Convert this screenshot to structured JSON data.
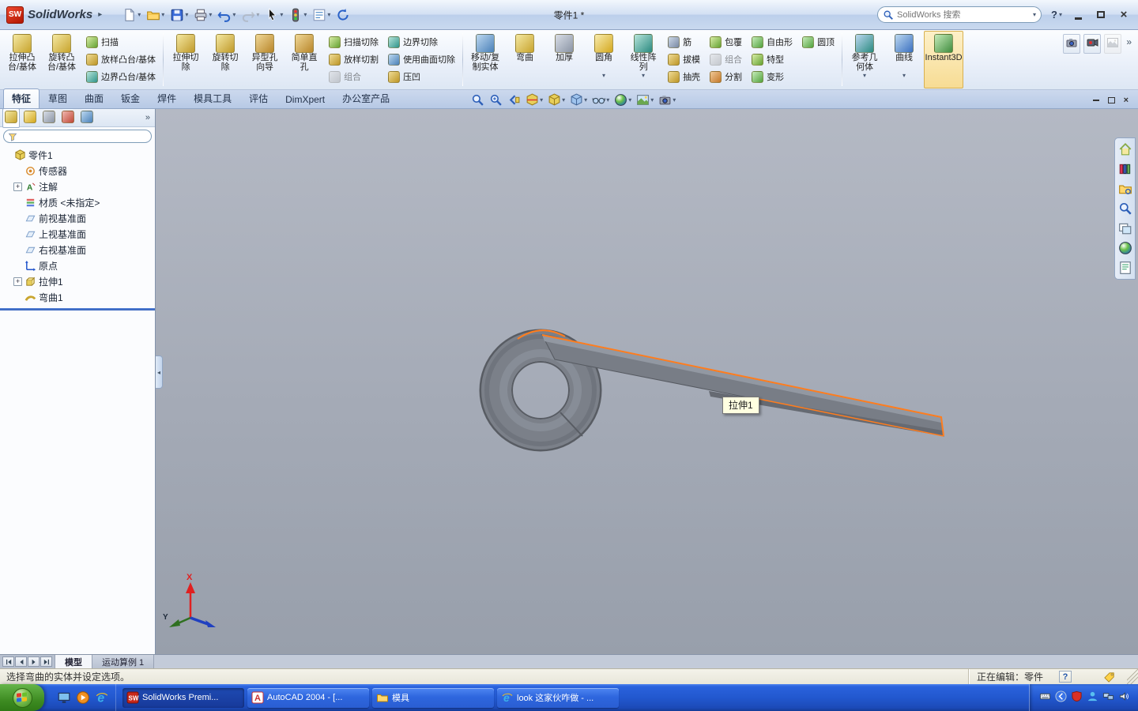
{
  "colors": {
    "selection_highlight": "#ff7d1e",
    "taskbar_blue": "#245edc",
    "viewport_gray": "#a6acb8",
    "accent_red": "#c8281a"
  },
  "titlebar": {
    "logo_badge": "SW",
    "logo_text": "SolidWorks",
    "doc_title": "零件1 *",
    "search_placeholder": "SolidWorks 搜索",
    "help_label": "?"
  },
  "quick_toolbar": [
    {
      "name": "new-document-button",
      "icon": "new-page-icon",
      "dropdown": true
    },
    {
      "name": "open-button",
      "icon": "open-folder-icon",
      "dropdown": true
    },
    {
      "name": "save-button",
      "icon": "save-icon",
      "dropdown": true
    },
    {
      "name": "print-button",
      "icon": "print-icon",
      "dropdown": true
    },
    {
      "name": "undo-button",
      "icon": "undo-icon",
      "dropdown": true
    },
    {
      "name": "redo-button",
      "icon": "redo-icon",
      "dropdown": true,
      "disabled": true
    },
    {
      "name": "select-button",
      "icon": "select-cursor-icon",
      "dropdown": true
    },
    {
      "name": "rebuild-button",
      "icon": "rebuild-icon",
      "dropdown": true
    },
    {
      "name": "options-button",
      "icon": "options-icon",
      "dropdown": true
    },
    {
      "name": "refresh-button",
      "icon": "refresh-icon",
      "dropdown": false
    }
  ],
  "ribbon": {
    "groups": [
      {
        "columns": [
          {
            "type": "big",
            "items": [
              {
                "name": "extruded-boss-button",
                "label_lines": [
                  "拉伸凸",
                  "台/基体"
                ],
                "icon": "extruded-boss-icon"
              },
              {
                "name": "revolved-boss-button",
                "label_lines": [
                  "旋转凸",
                  "台/基体"
                ],
                "icon": "revolved-boss-icon"
              }
            ]
          },
          {
            "type": "stack",
            "items": [
              {
                "name": "swept-boss-button",
                "label": "扫描",
                "icon": "swept-boss-icon"
              },
              {
                "name": "lofted-boss-button",
                "label": "放样凸台/基体",
                "icon": "lofted-boss-icon"
              },
              {
                "name": "boundary-boss-button",
                "label": "边界凸台/基体",
                "icon": "boundary-boss-icon"
              }
            ]
          }
        ]
      },
      {
        "columns": [
          {
            "type": "big",
            "items": [
              {
                "name": "extruded-cut-button",
                "label_lines": [
                  "拉伸切",
                  "除"
                ],
                "icon": "extruded-cut-icon"
              },
              {
                "name": "revolved-cut-button",
                "label_lines": [
                  "旋转切",
                  "除"
                ],
                "icon": "revolved-cut-icon"
              },
              {
                "name": "hole-wizard-button",
                "label_lines": [
                  "异型孔",
                  "向导"
                ],
                "icon": "hole-wizard-icon"
              },
              {
                "name": "simple-hole-button",
                "label_lines": [
                  "简单直",
                  "孔"
                ],
                "icon": "simple-hole-icon"
              }
            ]
          },
          {
            "type": "stack",
            "items": [
              {
                "name": "swept-cut-button",
                "label": "扫描切除",
                "icon": "swept-cut-icon"
              },
              {
                "name": "lofted-cut-button",
                "label": "放样切割",
                "icon": "lofted-cut-icon"
              },
              {
                "name": "combine-button",
                "label": "组合",
                "icon": "combine-icon",
                "disabled": true
              }
            ]
          },
          {
            "type": "stack",
            "items": [
              {
                "name": "boundary-cut-button",
                "label": "边界切除",
                "icon": "boundary-cut-icon"
              },
              {
                "name": "cut-with-surface-button",
                "label": "使用曲面切除",
                "icon": "cut-with-surface-icon"
              },
              {
                "name": "indent-button",
                "label": "压凹",
                "icon": "indent-icon"
              }
            ]
          }
        ]
      },
      {
        "columns": [
          {
            "type": "big",
            "items": [
              {
                "name": "move-copy-bodies-button",
                "label_lines": [
                  "移动/复",
                  "制实体"
                ],
                "icon": "move-copy-icon"
              },
              {
                "name": "flex-button",
                "label_lines": [
                  "弯曲",
                  ""
                ],
                "icon": "flex-icon"
              },
              {
                "name": "thicken-button",
                "label_lines": [
                  "加厚",
                  ""
                ],
                "icon": "thicken-icon"
              },
              {
                "name": "fillet-button",
                "label_lines": [
                  "圆角",
                  ""
                ],
                "icon": "fillet-icon",
                "dropdown": true
              },
              {
                "name": "linear-pattern-button",
                "label_lines": [
                  "线性阵",
                  "列"
                ],
                "icon": "linear-pattern-icon",
                "dropdown": true
              }
            ]
          },
          {
            "type": "stack",
            "items": [
              {
                "name": "rib-button",
                "label": "筋",
                "icon": "rib-icon"
              },
              {
                "name": "draft-button",
                "label": "拔模",
                "icon": "draft-icon"
              },
              {
                "name": "shell-button",
                "label": "抽壳",
                "icon": "shell-icon"
              }
            ]
          },
          {
            "type": "stack",
            "items": [
              {
                "name": "wrap-button",
                "label": "包覆",
                "icon": "wrap-icon"
              },
              {
                "name": "combine-bodies-button",
                "label": "组合",
                "icon": "combine-icon",
                "disabled": true
              },
              {
                "name": "split-button",
                "label": "分割",
                "icon": "split-icon"
              }
            ]
          },
          {
            "type": "stack",
            "items": [
              {
                "name": "freeform-button",
                "label": "自由形",
                "icon": "freeform-icon"
              },
              {
                "name": "shape-feature-button",
                "label": "特型",
                "icon": "shape-feature-icon"
              },
              {
                "name": "deform-button",
                "label": "变形",
                "icon": "deform-icon"
              }
            ]
          },
          {
            "type": "stack",
            "items": [
              {
                "name": "dome-button",
                "label": "圆顶",
                "icon": "dome-icon"
              }
            ]
          }
        ]
      },
      {
        "columns": [
          {
            "type": "big",
            "items": [
              {
                "name": "reference-geometry-button",
                "label_lines": [
                  "参考几",
                  "何体"
                ],
                "icon": "reference-geometry-icon",
                "dropdown": true
              },
              {
                "name": "curves-button",
                "label_lines": [
                  "曲线",
                  ""
                ],
                "icon": "curves-icon",
                "dropdown": true
              },
              {
                "name": "instant3d-button",
                "label_lines": [
                  "Instant3D",
                  ""
                ],
                "icon": "instant3d-icon",
                "active": true
              }
            ]
          }
        ]
      }
    ]
  },
  "ribbon_extras": [
    {
      "name": "screen-capture-button",
      "icon": "camera-icon"
    },
    {
      "name": "record-video-button",
      "icon": "record-icon"
    },
    {
      "name": "capture-options-button",
      "icon": "image-icon",
      "disabled": true
    }
  ],
  "more_chevron": "»",
  "command_tabs": [
    {
      "label": "特征",
      "active": true
    },
    {
      "label": "草图"
    },
    {
      "label": "曲面"
    },
    {
      "label": "钣金"
    },
    {
      "label": "焊件"
    },
    {
      "label": "模具工具"
    },
    {
      "label": "评估"
    },
    {
      "label": "DimXpert"
    },
    {
      "label": "办公室产品"
    }
  ],
  "view_toolbar": [
    {
      "name": "zoom-to-fit-button",
      "icon": "magnifier-icon"
    },
    {
      "name": "zoom-to-area-button",
      "icon": "magnifier-plus-icon"
    },
    {
      "name": "previous-view-button",
      "icon": "previous-view-icon"
    },
    {
      "name": "section-view-button",
      "icon": "section-view-icon",
      "dropdown": true
    },
    {
      "name": "view-orientation-button",
      "icon": "view-cube-icon",
      "dropdown": true
    },
    {
      "name": "display-style-button",
      "icon": "display-style-icon",
      "dropdown": true
    },
    {
      "name": "hide-show-items-button",
      "icon": "hide-show-icon",
      "dropdown": true
    },
    {
      "name": "edit-appearance-button",
      "icon": "appearance-sphere-icon",
      "dropdown": true
    },
    {
      "name": "apply-scene-button",
      "icon": "scene-icon",
      "dropdown": true
    },
    {
      "name": "view-settings-button",
      "icon": "camera-icon",
      "dropdown": true
    }
  ],
  "panel_tabs": [
    {
      "name": "featuremanager-tab",
      "icon": "feature-tree-icon",
      "active": true
    },
    {
      "name": "propertymanager-tab",
      "icon": "property-manager-icon"
    },
    {
      "name": "configurationmanager-tab",
      "icon": "configuration-manager-icon"
    },
    {
      "name": "dimxpertmanager-tab",
      "icon": "dimxpert-manager-icon"
    },
    {
      "name": "displaymanager-tab",
      "icon": "display-manager-icon"
    }
  ],
  "feature_tree": {
    "root": {
      "label": "零件1",
      "icon": "part-icon"
    },
    "items": [
      {
        "label": "传感器",
        "icon": "sensors-icon"
      },
      {
        "label": "注解",
        "icon": "annotations-icon",
        "expandable": true
      },
      {
        "label": "材质 <未指定>",
        "icon": "material-icon"
      },
      {
        "label": "前视基准面",
        "icon": "plane-icon"
      },
      {
        "label": "上视基准面",
        "icon": "plane-icon"
      },
      {
        "label": "右视基准面",
        "icon": "plane-icon"
      },
      {
        "label": "原点",
        "icon": "origin-icon"
      },
      {
        "label": "拉伸1",
        "icon": "extrude-feature-icon",
        "expandable": true
      },
      {
        "label": "弯曲1",
        "icon": "flex-feature-icon"
      }
    ]
  },
  "task_pane": [
    {
      "name": "solidworks-resources-tab",
      "icon": "home-icon"
    },
    {
      "name": "design-library-tab",
      "icon": "design-library-icon"
    },
    {
      "name": "file-explorer-tab",
      "icon": "file-explorer-icon"
    },
    {
      "name": "search-tab",
      "icon": "search-icon"
    },
    {
      "name": "view-palette-tab",
      "icon": "view-palette-icon"
    },
    {
      "name": "appearances-tab",
      "icon": "appearance-sphere-icon"
    },
    {
      "name": "custom-properties-tab",
      "icon": "custom-properties-icon"
    }
  ],
  "viewport": {
    "selection_tooltip": "拉伸1",
    "triad_labels": {
      "x": "X",
      "y": "Y"
    }
  },
  "bottom_tabs": {
    "items": [
      {
        "label": "模型",
        "active": true
      },
      {
        "label": "运动算例 1"
      }
    ]
  },
  "statusbar": {
    "message": "选择弯曲的实体并设定选项。",
    "editing_status": "正在编辑：零件",
    "help_badge": "?"
  },
  "taskbar": {
    "quick_launch": [
      {
        "name": "show-desktop-button",
        "icon": "show-desktop-icon"
      },
      {
        "name": "media-player-button",
        "icon": "media-player-icon"
      },
      {
        "name": "internet-explorer-button",
        "icon": "ie-icon"
      }
    ],
    "windows": [
      {
        "label": "SolidWorks Premi...",
        "icon": "solidworks-task-icon",
        "active": true
      },
      {
        "label": "AutoCAD 2004 - [...",
        "icon": "autocad-icon"
      },
      {
        "label": "模具",
        "icon": "folder-icon"
      },
      {
        "label": "look 这家伙咋做 - ...",
        "icon": "ie-icon"
      }
    ],
    "tray": [
      {
        "name": "input-method-icon"
      },
      {
        "name": "hidden-icons-chevron"
      },
      {
        "name": "antivirus-icon"
      },
      {
        "name": "messenger-icon"
      },
      {
        "name": "network-icon"
      },
      {
        "name": "volume-icon"
      }
    ]
  }
}
